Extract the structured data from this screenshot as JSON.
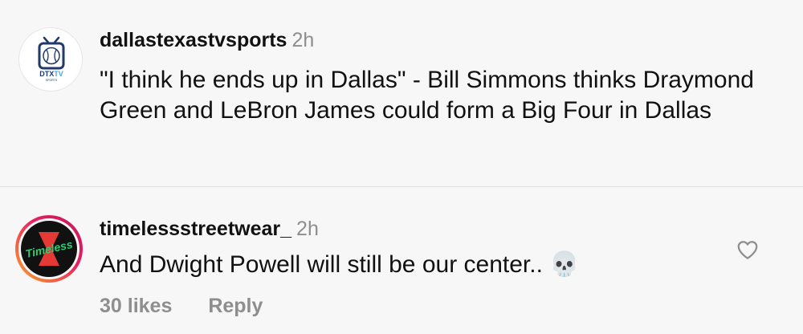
{
  "comments": [
    {
      "username": "dallastexastvsports",
      "time": "2h",
      "text": "\"I think he ends up in Dallas\" - Bill Simmons thinks Draymond Green and LeBron James could form a Big Four in Dallas",
      "avatar": {
        "label_main": "DTX",
        "label_accent": "TV",
        "label_sub": "SPORTS",
        "colors": {
          "navy": "#1f3a6b",
          "blue": "#4fa3e0"
        }
      }
    },
    {
      "username": "timelessstreetwear_",
      "time": "2h",
      "text": "And Dwight Powell will still be our center..",
      "emoji": "💀",
      "likes": "30 likes",
      "reply": "Reply",
      "avatar": {
        "label": "Timeless",
        "colors": {
          "ring_start": "#f9a825",
          "ring_end": "#c2185b",
          "bg": "#111111",
          "logo": "#2ecc71"
        }
      }
    }
  ]
}
